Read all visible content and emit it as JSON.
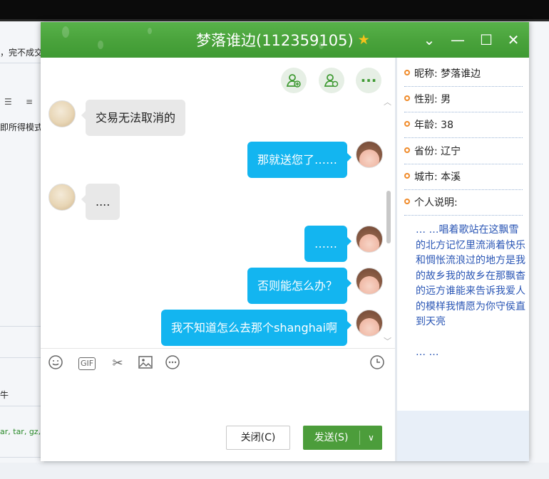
{
  "background": {
    "snippet1": "，完不成交",
    "snippet2": "即所得模式",
    "snippet3": "ar, tar, gz, b",
    "snippet4": "牛"
  },
  "window": {
    "title": "梦落谁边(112359105)",
    "title_icon": "star-icon",
    "controls": [
      "chevron-down-icon",
      "minimize-icon",
      "maximize-icon",
      "close-icon"
    ]
  },
  "chat": {
    "top_actions": [
      "add-friend-icon",
      "user-settings-icon",
      "more-icon"
    ],
    "messages": [
      {
        "side": "left",
        "text": "交易无法取消的"
      },
      {
        "side": "right",
        "text": "那就送您了……"
      },
      {
        "side": "left",
        "text": "...."
      },
      {
        "side": "right",
        "text": "……"
      },
      {
        "side": "right",
        "text": "否则能怎么办？"
      },
      {
        "side": "right",
        "text": "我不知道怎么去那个shanghai啊"
      }
    ]
  },
  "toolbar": {
    "tools": [
      "emoji-icon",
      "gif-icon",
      "scissors-icon",
      "image-icon",
      "more-icon",
      "history-icon"
    ],
    "gif_label": "GIF"
  },
  "buttons": {
    "close_label": "关闭(C)",
    "send_label": "发送(S)"
  },
  "profile": {
    "nickname": "昵称:  梦落谁边",
    "gender": "性别:  男",
    "age": "年龄:  38",
    "province": "省份:  辽宁",
    "city": "城市:  本溪",
    "bio_label": "个人说明:",
    "bio_text": "…  …唱着歌站在这飘雪的北方记忆里流淌着快乐和惆怅流浪过的地方是我的故乡我的故乡在那飘杳的远方谁能来告诉我爱人的模样我情愿为你守侯直到天亮",
    "bio_more": "…  …"
  },
  "colors": {
    "titlebar": "#4aa33c",
    "bubble_right": "#13b5f0",
    "bubble_left": "#e8e8e8",
    "send_button": "#4c9d3b",
    "link_text": "#2a56b5",
    "bullet": "#f08b2a"
  }
}
